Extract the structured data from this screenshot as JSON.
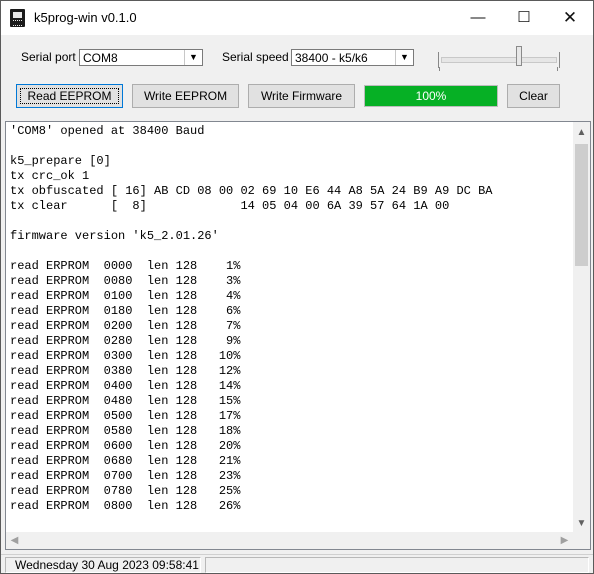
{
  "window": {
    "title": "k5prog-win v0.1.0",
    "icon": "radio-app-icon"
  },
  "controls": {
    "serial_port_label": "Serial port",
    "serial_port_value": "COM8",
    "serial_speed_label": "Serial speed",
    "serial_speed_value": "38400 - k5/k6"
  },
  "buttons": {
    "read_eeprom": "Read EEPROM",
    "write_eeprom": "Write EEPROM",
    "write_firmware": "Write Firmware",
    "clear": "Clear"
  },
  "progress": {
    "value": 1.0,
    "text": "100%",
    "color": "#06b025"
  },
  "log": {
    "lines": [
      "'COM8' opened at 38400 Baud",
      "",
      "k5_prepare [0]",
      "tx crc_ok 1",
      "tx obfuscated [ 16] AB CD 08 00 02 69 10 E6 44 A8 5A 24 B9 A9 DC BA",
      "tx clear      [  8]             14 05 04 00 6A 39 57 64 1A 00",
      "",
      "firmware version 'k5_2.01.26'",
      "",
      "read ERPROM  0000  len 128    1%",
      "read ERPROM  0080  len 128    3%",
      "read ERPROM  0100  len 128    4%",
      "read ERPROM  0180  len 128    6%",
      "read ERPROM  0200  len 128    7%",
      "read ERPROM  0280  len 128    9%",
      "read ERPROM  0300  len 128   10%",
      "read ERPROM  0380  len 128   12%",
      "read ERPROM  0400  len 128   14%",
      "read ERPROM  0480  len 128   15%",
      "read ERPROM  0500  len 128   17%",
      "read ERPROM  0580  len 128   18%",
      "read ERPROM  0600  len 128   20%",
      "read ERPROM  0680  len 128   21%",
      "read ERPROM  0700  len 128   23%",
      "read ERPROM  0780  len 128   25%",
      "read ERPROM  0800  len 128   26%"
    ]
  },
  "status": {
    "datetime": "Wednesday 30 Aug 2023  09:58:41"
  },
  "colors": {
    "accent_focus": "#0078d7",
    "progress_fill": "#06b025"
  }
}
